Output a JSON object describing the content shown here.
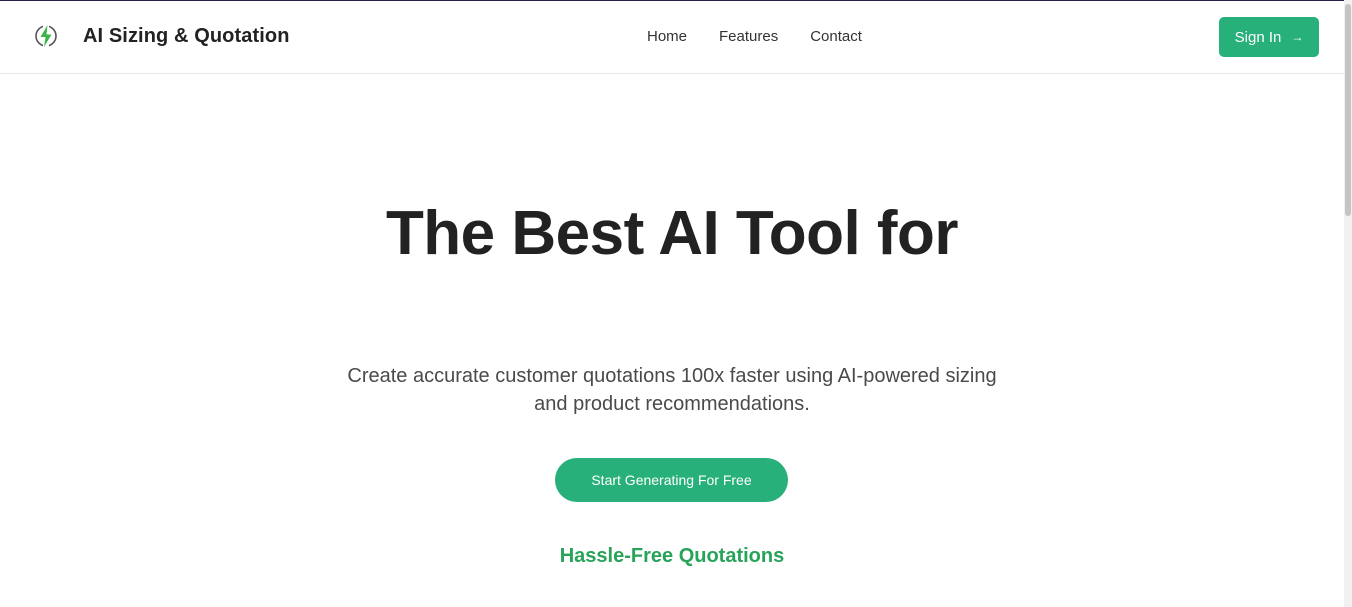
{
  "brand": {
    "name": "AI Sizing & Quotation",
    "icon": "lightning-bolt-icon"
  },
  "nav": {
    "items": [
      {
        "label": "Home"
      },
      {
        "label": "Features"
      },
      {
        "label": "Contact"
      }
    ]
  },
  "signin": {
    "label": "Sign In",
    "arrow": "→"
  },
  "hero": {
    "title": "The Best AI Tool for",
    "subtitle": "Create accurate customer quotations 100x faster using AI-powered sizing and product recommendations.",
    "cta_label": "Start Generating For Free",
    "tagline": "Hassle-Free Quotations"
  },
  "colors": {
    "accent": "#27b07a",
    "tagline": "#27a35a",
    "text": "#222222"
  }
}
